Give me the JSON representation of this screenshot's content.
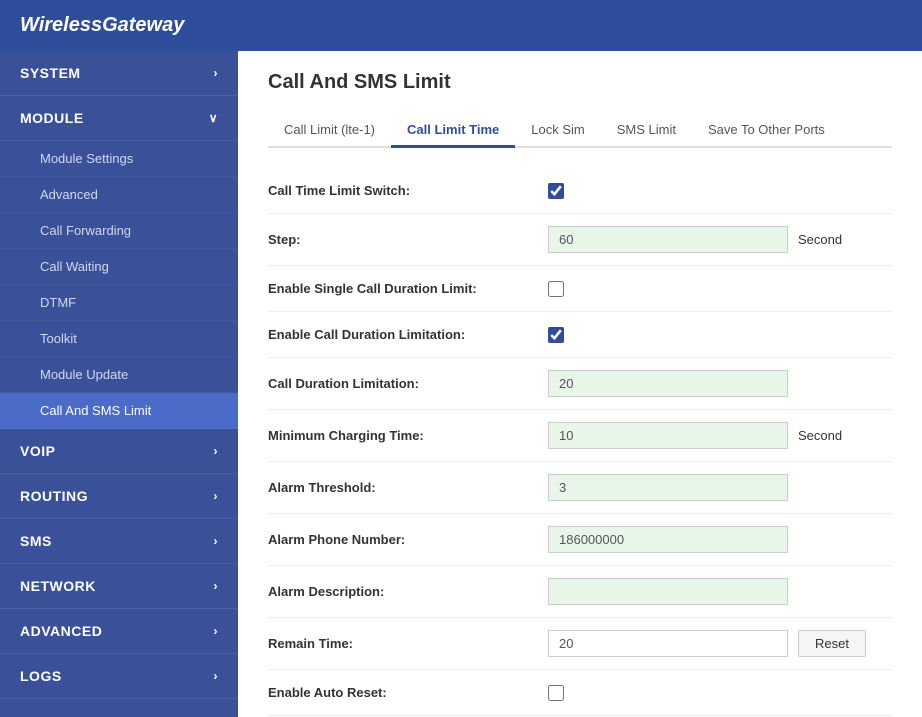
{
  "header": {
    "title": "WirelessGateway"
  },
  "sidebar": {
    "items": [
      {
        "id": "system",
        "label": "SYSTEM",
        "icon": "chevron-right",
        "expanded": false,
        "children": []
      },
      {
        "id": "module",
        "label": "MODULE",
        "icon": "chevron-down",
        "expanded": true,
        "children": [
          {
            "id": "module-settings",
            "label": "Module Settings",
            "active": false
          },
          {
            "id": "advanced",
            "label": "Advanced",
            "active": false
          },
          {
            "id": "call-forwarding",
            "label": "Call Forwarding",
            "active": false
          },
          {
            "id": "call-waiting",
            "label": "Call Waiting",
            "active": false
          },
          {
            "id": "dtmf",
            "label": "DTMF",
            "active": false
          },
          {
            "id": "toolkit",
            "label": "Toolkit",
            "active": false
          },
          {
            "id": "module-update",
            "label": "Module Update",
            "active": false
          },
          {
            "id": "call-sms-limit",
            "label": "Call And SMS Limit",
            "active": true
          }
        ]
      },
      {
        "id": "voip",
        "label": "VOIP",
        "icon": "chevron-right",
        "expanded": false,
        "children": []
      },
      {
        "id": "routing",
        "label": "ROUTING",
        "icon": "chevron-right",
        "expanded": false,
        "children": []
      },
      {
        "id": "sms",
        "label": "SMS",
        "icon": "chevron-right",
        "expanded": false,
        "children": []
      },
      {
        "id": "network",
        "label": "NETWORK",
        "icon": "chevron-right",
        "expanded": false,
        "children": []
      },
      {
        "id": "advanced-top",
        "label": "ADVANCED",
        "icon": "chevron-right",
        "expanded": false,
        "children": []
      },
      {
        "id": "logs",
        "label": "LOGS",
        "icon": "chevron-right",
        "expanded": false,
        "children": []
      }
    ]
  },
  "main": {
    "page_title": "Call And SMS Limit",
    "tabs": [
      {
        "id": "call-limit",
        "label": "Call Limit (lte-1)",
        "active": false
      },
      {
        "id": "call-limit-time",
        "label": "Call Limit Time",
        "active": true
      },
      {
        "id": "lock-sim",
        "label": "Lock Sim",
        "active": false
      },
      {
        "id": "sms-limit",
        "label": "SMS Limit",
        "active": false
      },
      {
        "id": "save-to-other-ports",
        "label": "Save To Other Ports",
        "active": false
      }
    ],
    "form": {
      "rows": [
        {
          "id": "call-time-limit-switch",
          "label": "Call Time Limit Switch:",
          "type": "checkbox",
          "checked": true,
          "unit": ""
        },
        {
          "id": "step",
          "label": "Step:",
          "type": "input-green",
          "value": "60",
          "unit": "Second"
        },
        {
          "id": "enable-single-call-duration-limit",
          "label": "Enable Single Call Duration Limit:",
          "type": "checkbox",
          "checked": false,
          "unit": ""
        },
        {
          "id": "enable-call-duration-limitation",
          "label": "Enable Call Duration Limitation:",
          "type": "checkbox",
          "checked": true,
          "unit": ""
        },
        {
          "id": "call-duration-limitation",
          "label": "Call Duration Limitation:",
          "type": "input-green",
          "value": "20",
          "unit": ""
        },
        {
          "id": "minimum-charging-time",
          "label": "Minimum Charging Time:",
          "type": "input-green",
          "value": "10",
          "unit": "Second"
        },
        {
          "id": "alarm-threshold",
          "label": "Alarm Threshold:",
          "type": "input-green",
          "value": "3",
          "unit": ""
        },
        {
          "id": "alarm-phone-number",
          "label": "Alarm Phone Number:",
          "type": "input-green",
          "value": "186000000",
          "unit": ""
        },
        {
          "id": "alarm-description",
          "label": "Alarm Description:",
          "type": "input-green",
          "value": "",
          "unit": ""
        },
        {
          "id": "remain-time",
          "label": "Remain Time:",
          "type": "input-white-reset",
          "value": "20",
          "unit": "",
          "button": "Reset"
        },
        {
          "id": "enable-auto-reset",
          "label": "Enable Auto Reset:",
          "type": "checkbox",
          "checked": false,
          "unit": ""
        }
      ]
    }
  }
}
